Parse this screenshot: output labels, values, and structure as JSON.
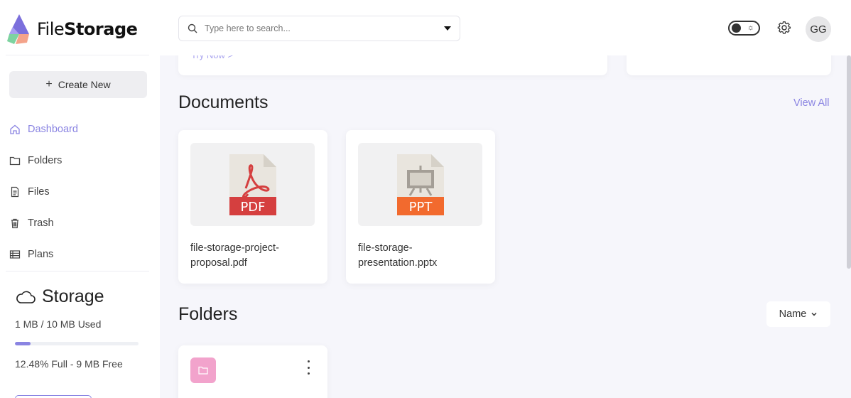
{
  "app": {
    "logo_text_regular": "File",
    "logo_text_bold": "Storage"
  },
  "sidebar": {
    "create_label": "Create New",
    "items": [
      {
        "label": "Dashboard",
        "icon": "home-icon",
        "active": true
      },
      {
        "label": "Folders",
        "icon": "folder-icon",
        "active": false
      },
      {
        "label": "Files",
        "icon": "file-icon",
        "active": false
      },
      {
        "label": "Trash",
        "icon": "trash-icon",
        "active": false
      },
      {
        "label": "Plans",
        "icon": "plans-icon",
        "active": false
      }
    ],
    "storage": {
      "title": "Storage",
      "used_text": "1 MB / 10 MB Used",
      "percent_full": 12.48,
      "free_text": "12.48% Full - 9 MB Free"
    }
  },
  "header": {
    "search_placeholder": "Type here to search...",
    "avatar_initials": "GG"
  },
  "main": {
    "try_now": "Try Now  >",
    "documents_title": "Documents",
    "view_all": "View All",
    "documents": [
      {
        "name": "file-storage-project-proposal.pdf",
        "type_label": "PDF",
        "color": "#d53f3f"
      },
      {
        "name": "file-storage-presentation.pptx",
        "type_label": "PPT",
        "color": "#f26a2e"
      }
    ],
    "folders_title": "Folders",
    "sort_label": "Name"
  },
  "colors": {
    "accent": "#8a84e2",
    "folder_badge": "#f2a3cc"
  }
}
